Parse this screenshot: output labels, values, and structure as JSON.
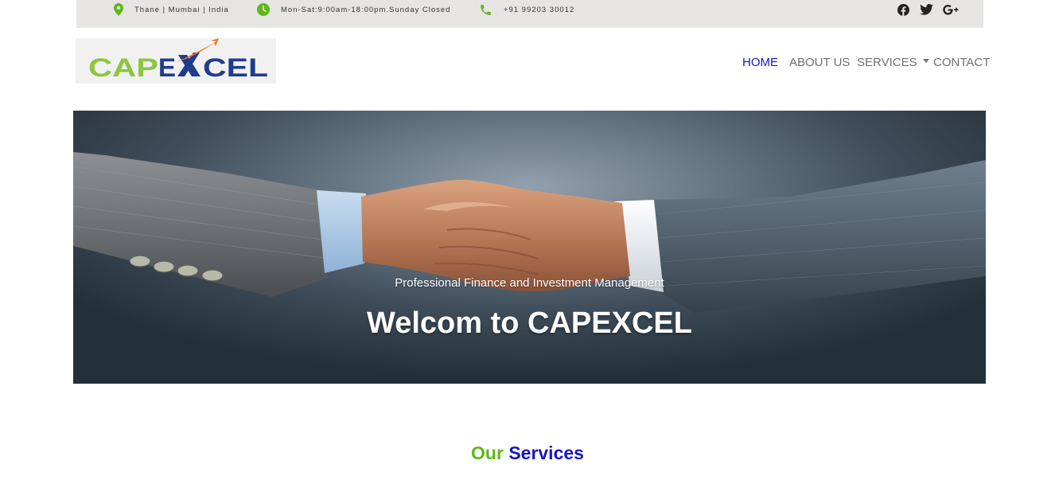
{
  "topbar": {
    "location": "Thane | Mumbai | India",
    "hours": "Mon-Sat:9:00am-18:00pm.Sunday Closed",
    "phone": "+91 99203 30012",
    "icon_color": "#5fb81a",
    "social": [
      "facebook-icon",
      "twitter-icon",
      "google-plus-icon"
    ]
  },
  "brand": {
    "logo_part1": "CAP",
    "logo_part2": "E",
    "logo_part3": "CEL",
    "colors": {
      "green": "#8cc63f",
      "navy": "#1f3c8f",
      "orange": "#f47920"
    }
  },
  "nav": {
    "home": "HOME",
    "about": "ABOUT US",
    "services": "SERVICES",
    "contact": "CONTACT",
    "active_color": "#1616c8",
    "link_color": "#707070"
  },
  "hero": {
    "subtitle": "Professional Finance and Investment Management",
    "title": "Welcom to CAPEXCEL"
  },
  "section": {
    "title_word1": "Our",
    "title_word2": "Services"
  }
}
